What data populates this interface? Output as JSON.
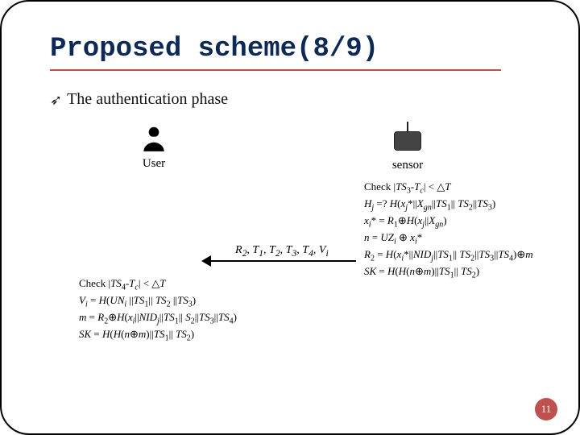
{
  "title": "Proposed scheme(8/9)",
  "subtitle": "The authentication phase",
  "actors": {
    "user": "User",
    "sensor": "sensor"
  },
  "arrow_label_prefix": "R",
  "arrow_label_rest": "₂, T₁, T₂, T₃, T₄, Vᵢ",
  "arrow_label_plain": "R2, T1, T2, T3, T4, Vi",
  "sensor_block": {
    "l1": "Check |TS₃-T_c| < △T",
    "l2": "H_j =? H(x_j*||X_gn||TS₁|| TS₂||TS₃)",
    "l3": "x_i* = R₁⊕H(x_j||X_gn)",
    "l4": "n = UZ_i ⊕ x_i*",
    "l5": "R₂ = H(x_i*||NID_j||TS₁|| TS₂||TS₃||TS₄)⊕m",
    "l6": "SK = H(H(n⊕m)||TS₁|| TS₂)"
  },
  "user_block": {
    "l1": "Check |TS₄-T_c| < △T",
    "l2": "V_i = H(UN_i ||TS₁|| TS₂ ||TS₃)",
    "l3": "m = R₂⊕H(x_i||NID_j||TS₁|| S₂||TS₃||TS₄)",
    "l4": "SK = H(H(n⊕m)||TS₁|| TS₂)"
  },
  "page_number": "11",
  "chart_data": {
    "type": "table",
    "title": "Authentication phase message flow (sensor → user) and computations",
    "message": {
      "direction": "sensor_to_user",
      "fields": [
        "R2",
        "T1",
        "T2",
        "T3",
        "T4",
        "Vi"
      ]
    },
    "sensor_computations": [
      "Check |TS3 - Tc| < △T",
      "Hj =? H(xj* || Xgn || TS1 || TS2 || TS3)",
      "xi* = R1 ⊕ H(xj || Xgn)",
      "n = UZi ⊕ xi*",
      "R2 = H(xi* || NIDj || TS1 || TS2 || TS3 || TS4) ⊕ m",
      "SK = H(H(n ⊕ m) || TS1 || TS2)"
    ],
    "user_computations": [
      "Check |TS4 - Tc| < △T",
      "Vi = H(UNi || TS1 || TS2 || TS3)",
      "m = R2 ⊕ H(xi || NIDj || TS1 || S2 || TS3 || TS4)",
      "SK = H(H(n ⊕ m) || TS1 || TS2)"
    ]
  }
}
